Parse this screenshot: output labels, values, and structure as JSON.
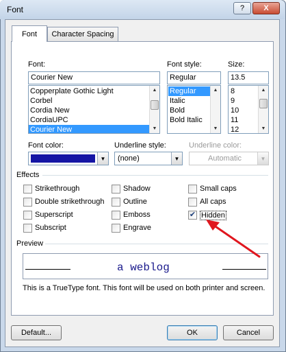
{
  "window": {
    "title": "Font",
    "help": "?",
    "close": "X"
  },
  "tabs": [
    {
      "label": "Font"
    },
    {
      "label": "Character Spacing"
    }
  ],
  "font": {
    "label": "Font:",
    "value": "Courier New",
    "items": [
      "Copperplate Gothic Light",
      "Corbel",
      "Cordia New",
      "CordiaUPC",
      "Courier New"
    ],
    "selected": "Courier New"
  },
  "font_style": {
    "label": "Font style:",
    "value": "Regular",
    "items": [
      "Regular",
      "Italic",
      "Bold",
      "Bold Italic"
    ],
    "selected": "Regular"
  },
  "size": {
    "label": "Size:",
    "value": "13.5",
    "items": [
      "8",
      "9",
      "10",
      "11",
      "12"
    ]
  },
  "font_color": {
    "label": "Font color:",
    "swatch": "#1515a4"
  },
  "underline_style": {
    "label": "Underline style:",
    "value": "(none)"
  },
  "underline_color": {
    "label": "Underline color:",
    "value": "Automatic"
  },
  "effects": {
    "label": "Effects",
    "items": [
      {
        "label": "Strikethrough",
        "checked": false
      },
      {
        "label": "Double strikethrough",
        "checked": false
      },
      {
        "label": "Superscript",
        "checked": false
      },
      {
        "label": "Subscript",
        "checked": false
      },
      {
        "label": "Shadow",
        "checked": false
      },
      {
        "label": "Outline",
        "checked": false
      },
      {
        "label": "Emboss",
        "checked": false
      },
      {
        "label": "Engrave",
        "checked": false
      },
      {
        "label": "Small caps",
        "checked": false
      },
      {
        "label": "All caps",
        "checked": false
      },
      {
        "label": "Hidden",
        "checked": true
      }
    ]
  },
  "preview": {
    "label": "Preview",
    "sample": "a weblog",
    "note": "This is a TrueType font. This font will be used on both printer and screen."
  },
  "buttons": {
    "default": "Default...",
    "ok": "OK",
    "cancel": "Cancel"
  },
  "colors": {
    "accent_selection": "#3399ff",
    "annotation_arrow": "#e0161e"
  }
}
